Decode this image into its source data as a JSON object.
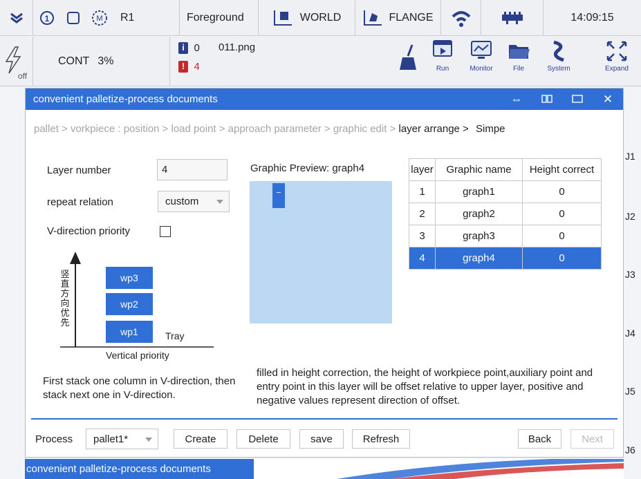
{
  "topbar": {
    "robot": "R1",
    "mode": "Foreground",
    "coord": "WORLD",
    "tool": "FLANGE",
    "time": "14:09:15"
  },
  "secondbar": {
    "power_sub": "off",
    "run_mode": "CONT",
    "speed": "3%",
    "info_count": "0",
    "error_count": "4",
    "file": "011.png",
    "tools": [
      {
        "label": "Run"
      },
      {
        "label": "Monitor"
      },
      {
        "label": "File"
      },
      {
        "label": "System"
      },
      {
        "label": "Expand"
      }
    ]
  },
  "dialog": {
    "title": "convenient palletize-process documents",
    "breadcrumb": [
      "pallet >",
      "vorkpiece :",
      "position >",
      "load point >",
      "approach parameter >",
      "graphic edit >"
    ],
    "breadcrumb_active": "layer arrange >",
    "breadcrumb_last": "Simpe",
    "form": {
      "layer_number_label": "Layer number",
      "layer_number_value": "4",
      "repeat_label": "repeat relation",
      "repeat_value": "custom",
      "vdir_label": "V-direction priority"
    },
    "diagram": {
      "axis_chars": [
        "竖",
        "直",
        "方",
        "向",
        "优",
        "先"
      ],
      "wp3": "wp3",
      "wp2": "wp2",
      "wp1": "wp1",
      "tray": "Tray",
      "caption": "Vertical priority"
    },
    "preview_title": "Graphic Preview: graph4",
    "table": {
      "headers": [
        "layer",
        "Graphic name",
        "Height correct"
      ],
      "rows": [
        {
          "layer": "1",
          "name": "graph1",
          "height": "0"
        },
        {
          "layer": "2",
          "name": "graph2",
          "height": "0"
        },
        {
          "layer": "3",
          "name": "graph3",
          "height": "0"
        },
        {
          "layer": "4",
          "name": "graph4",
          "height": "0"
        }
      ],
      "selected_row": 3
    },
    "desc_left": "First stack one column in V-direction, then stack next one in V-direction.",
    "desc_right": "filled in height correction, the height of workpiece point,auxiliary point and entry point in this layer will be offset relative to upper layer, positive and negative values represent direction of offset.",
    "footer": {
      "process_label": "Process",
      "process_value": "pallet1*",
      "create": "Create",
      "delete": "Delete",
      "save": "save",
      "refresh": "Refresh",
      "back": "Back",
      "next": "Next"
    }
  },
  "joints": [
    "J1",
    "J2",
    "J3",
    "J4",
    "J5",
    "J6"
  ],
  "bottom_status": "convenient palletize-process documents",
  "colors": {
    "accent": "#2f6fd6",
    "error": "#c7282c",
    "info": "#2a3e8a"
  }
}
